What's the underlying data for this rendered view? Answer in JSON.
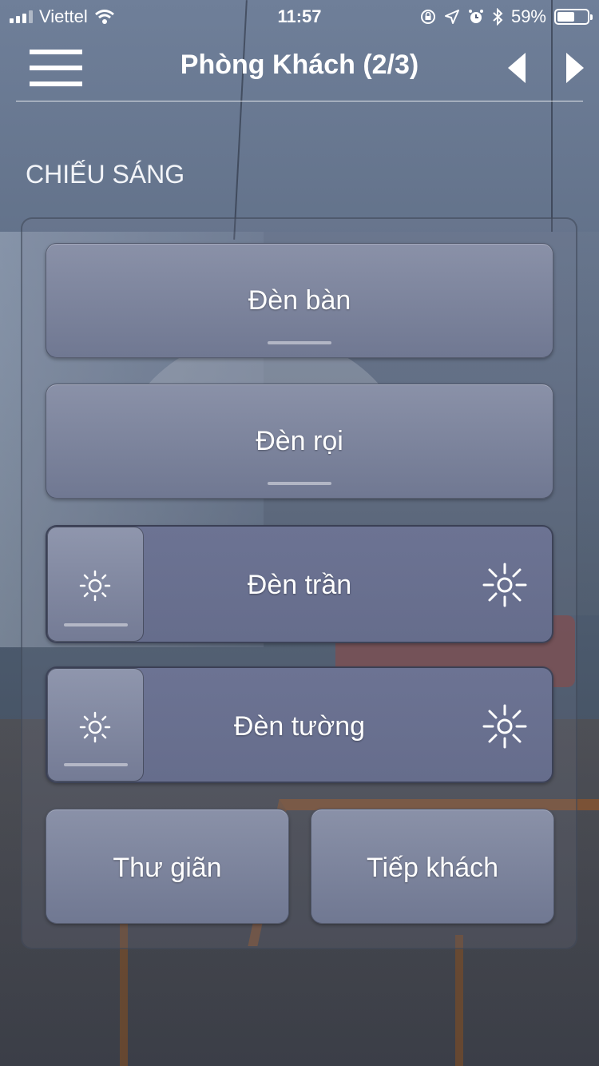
{
  "status_bar": {
    "carrier": "Viettel",
    "time": "11:57",
    "battery": "59%",
    "battery_level": 0.59
  },
  "header": {
    "title": "Phòng Khách (2/3)"
  },
  "section": {
    "title": "CHIẾU SÁNG"
  },
  "lights": {
    "den_ban": {
      "label": "Đèn bàn"
    },
    "den_roi": {
      "label": "Đèn rọi"
    },
    "den_tran": {
      "label": "Đèn trần",
      "level": 0
    },
    "den_tuong": {
      "label": "Đèn tường",
      "level": 0
    }
  },
  "scenes": {
    "relax": {
      "label": "Thư giãn"
    },
    "guests": {
      "label": "Tiếp khách"
    }
  }
}
